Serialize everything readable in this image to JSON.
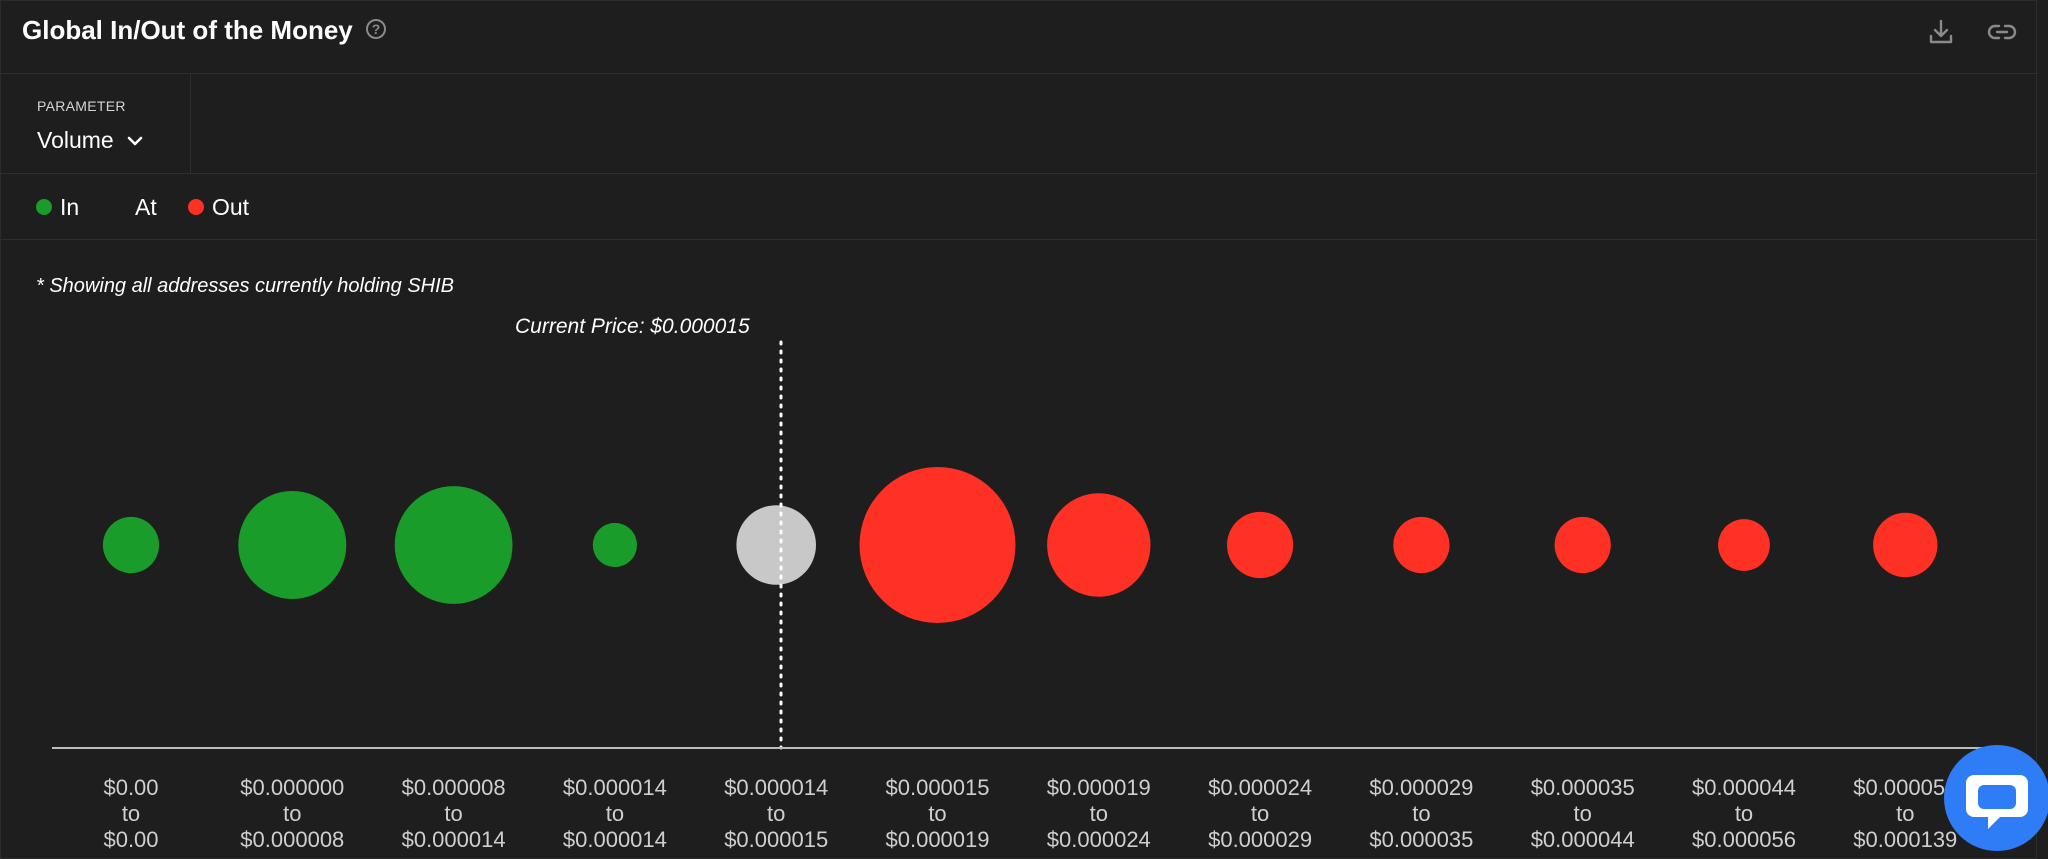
{
  "header": {
    "title": "Global In/Out of the Money",
    "help_icon": "help-circle-icon",
    "download_icon": "download-icon",
    "link_icon": "link-icon"
  },
  "parameter": {
    "label": "PARAMETER",
    "value": "Volume"
  },
  "legend": {
    "items": [
      {
        "label": "In",
        "color": "#1a9c2a"
      },
      {
        "label": "At",
        "color": ""
      },
      {
        "label": "Out",
        "color": "#ff3124"
      }
    ]
  },
  "note": "* Showing all addresses currently holding SHIB",
  "current_price_label": "Current Price: $0.000015",
  "colors": {
    "in": "#1a9c2a",
    "at": "#c8c8c8",
    "out": "#ff3124"
  },
  "chart_data": {
    "type": "scatter",
    "current_price": 1.5e-05,
    "bins": [
      {
        "from": "$0.00",
        "to": "$0.00",
        "status": "in",
        "relative_volume": 0.13
      },
      {
        "from": "$0.000000",
        "to": "$0.000008",
        "status": "in",
        "relative_volume": 0.48
      },
      {
        "from": "$0.000008",
        "to": "$0.000014",
        "status": "in",
        "relative_volume": 0.57
      },
      {
        "from": "$0.000014",
        "to": "$0.000014",
        "status": "in",
        "relative_volume": 0.08
      },
      {
        "from": "$0.000014",
        "to": "$0.000015",
        "status": "at",
        "relative_volume": 0.26
      },
      {
        "from": "$0.000015",
        "to": "$0.000019",
        "status": "out",
        "relative_volume": 1.0
      },
      {
        "from": "$0.000019",
        "to": "$0.000024",
        "status": "out",
        "relative_volume": 0.44
      },
      {
        "from": "$0.000024",
        "to": "$0.000029",
        "status": "out",
        "relative_volume": 0.18
      },
      {
        "from": "$0.000029",
        "to": "$0.000035",
        "status": "out",
        "relative_volume": 0.13
      },
      {
        "from": "$0.000035",
        "to": "$0.000044",
        "status": "out",
        "relative_volume": 0.13
      },
      {
        "from": "$0.000044",
        "to": "$0.000056",
        "status": "out",
        "relative_volume": 0.11
      },
      {
        "from": "$0.000056",
        "to": "$0.000139",
        "status": "out",
        "relative_volume": 0.17
      }
    ],
    "connector": "to",
    "grid": false
  },
  "chat_icon": "chat-bubble-icon"
}
